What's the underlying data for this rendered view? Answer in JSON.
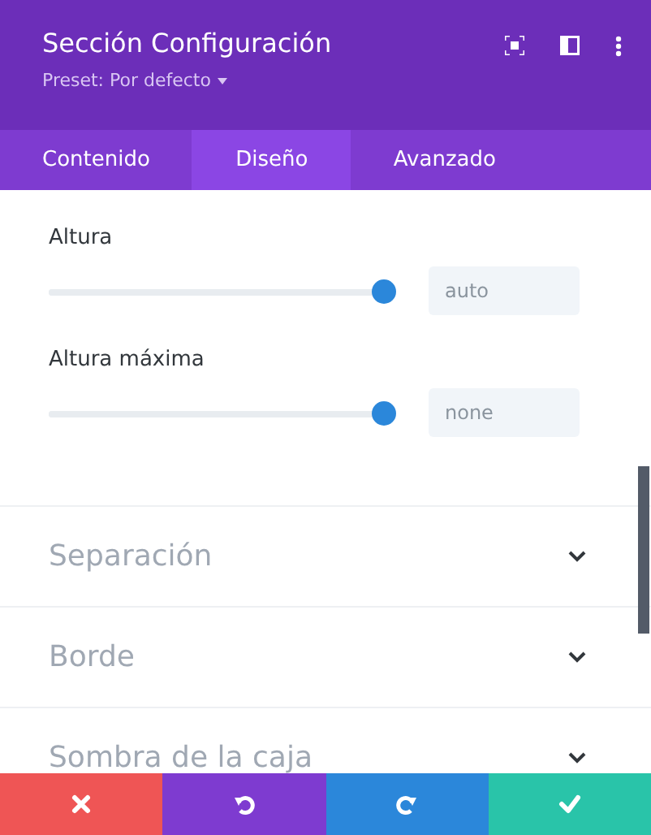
{
  "header": {
    "title": "Sección Configuración",
    "preset": "Preset: Por defecto"
  },
  "tabs": [
    {
      "label": "Contenido",
      "selected": false
    },
    {
      "label": "Diseño",
      "selected": true
    },
    {
      "label": "Avanzado",
      "selected": false
    }
  ],
  "sliders": [
    {
      "label": "Altura",
      "level": 1,
      "value": "auto"
    },
    {
      "label": "Altura máxima",
      "level": 1,
      "value": "none"
    }
  ],
  "sections": [
    {
      "title": "Separación",
      "expanded": false
    },
    {
      "title": "Borde",
      "expanded": false
    },
    {
      "title": "Sombra de la caja",
      "expanded": false
    }
  ],
  "actions": [
    {
      "kind": "cancel"
    },
    {
      "kind": "undo"
    },
    {
      "kind": "redo"
    },
    {
      "kind": "save"
    }
  ]
}
